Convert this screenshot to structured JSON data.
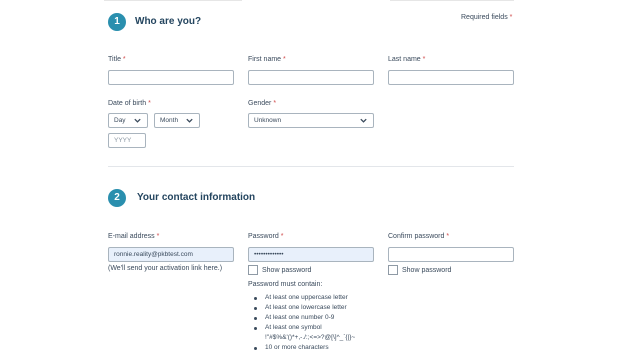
{
  "section1": {
    "number": "1",
    "title": "Who are you?",
    "required_note": "Required fields",
    "required_star": "*",
    "fields": {
      "title_label": "Title",
      "first_name_label": "First name",
      "last_name_label": "Last name",
      "dob_label": "Date of birth",
      "gender_label": "Gender",
      "day_value": "Day",
      "month_value": "Month",
      "year_placeholder": "YYYY",
      "gender_value": "Unknown"
    }
  },
  "section2": {
    "number": "2",
    "title": "Your contact information",
    "fields": {
      "email_label": "E-mail address",
      "password_label": "Password",
      "confirm_label": "Confirm password",
      "email_value": "ronnie.reality@pkbtest.com",
      "password_value": "•••••••••••••",
      "email_hint": "(We'll send your activation link here.)",
      "show_password": "Show password",
      "show_password_confirm": "Show password",
      "rules_heading": "Password must contain:",
      "rules": [
        "At least one uppercase letter",
        "At least one lowercase letter",
        "At least one number 0-9",
        "At least one symbol"
      ],
      "symbols": "!\"#$%&'()*+,-./:;<=>?@[\\]^_`{|}~",
      "rules_more": "10 or more characters"
    }
  },
  "icons": {
    "dropdown": "chevron-down-icon"
  },
  "colors": {
    "accent": "#2a8fae",
    "heading": "#24455f",
    "required": "#d04a4a",
    "autofill": "#e8f0fb"
  }
}
